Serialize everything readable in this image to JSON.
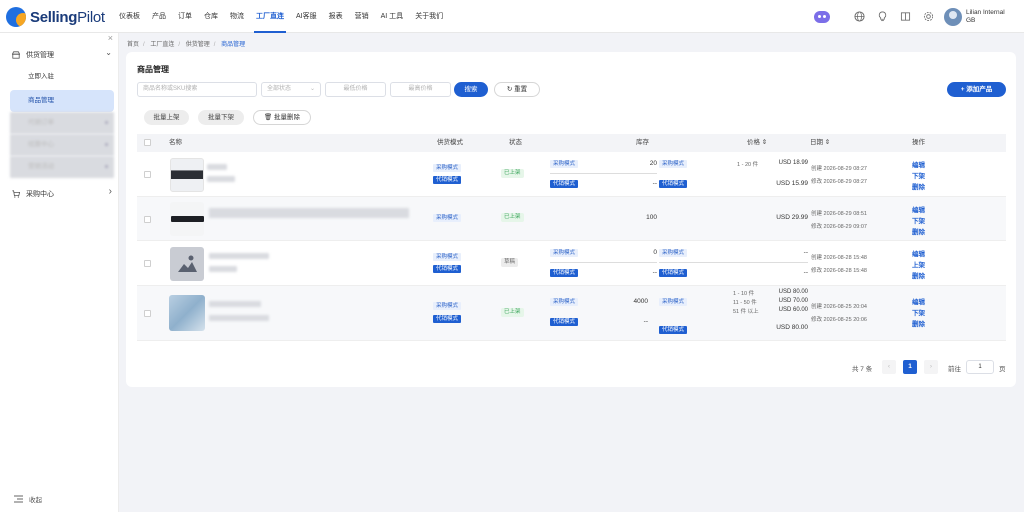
{
  "app": {
    "name_bold": "Selling",
    "name_light": "Pilot"
  },
  "nav": [
    "仪表板",
    "产品",
    "订单",
    "仓库",
    "物流",
    "工厂直连",
    "AI客服",
    "报表",
    "营销",
    "AI 工具",
    "关于我们"
  ],
  "user": {
    "name": "Lilian Internal",
    "sub": "GB"
  },
  "sidebar": {
    "close": "×",
    "groups": [
      {
        "label": "供货管理",
        "chev": "⌄"
      },
      {
        "label": "采购中心",
        "chev": "›"
      }
    ],
    "items": [
      "立即入驻",
      "商品管理",
      "代销订单",
      "结算中心",
      "营销活动"
    ],
    "footer": "收起"
  },
  "breadcrumb": [
    "首页",
    "工厂直连",
    "供货管理",
    "商品管理"
  ],
  "page_title": "商品管理",
  "filters": {
    "search_placeholder": "商品名称或SKU搜索",
    "status_placeholder": "全部状态",
    "min_price_placeholder": "最低价格",
    "max_price_placeholder": "最高价格",
    "search_btn": "搜索",
    "reset_btn": "重置",
    "add_btn": "+ 添加产品"
  },
  "batch": {
    "up": "批量上架",
    "down": "批量下架",
    "delete": "批量删除"
  },
  "table": {
    "headers": {
      "name": "名称",
      "mode": "供货模式",
      "status": "状态",
      "stock": "库存",
      "price": "价格 ⇕",
      "date": "日期 ⇕",
      "ops": "操作"
    },
    "rows": [
      {
        "modes": [
          "采购模式",
          "代销模式"
        ],
        "status": "已上架",
        "stock": [
          {
            "tag": "采购模式",
            "val": "20"
          },
          {
            "tag": "代销模式",
            "val": "--"
          }
        ],
        "price": [
          {
            "tag": "采购模式",
            "tier": "1 - 20 件",
            "val": "USD 18.99"
          },
          {
            "tag": "代销模式",
            "val": "USD 15.99"
          }
        ],
        "date": [
          "创建 2026-08-29 08:27",
          "修改 2026-08-29 08:27"
        ],
        "ops": [
          "编辑",
          "下架",
          "删除"
        ]
      },
      {
        "modes": [
          "采购模式"
        ],
        "status": "已上架",
        "stock_single": "100",
        "price_single": "USD 29.99",
        "date": [
          "创建 2026-08-29 08:51",
          "修改 2026-08-29 09:07"
        ],
        "ops": [
          "编辑",
          "下架",
          "删除"
        ]
      },
      {
        "modes": [
          "采购模式",
          "代销模式"
        ],
        "status": "草稿",
        "stock": [
          {
            "tag": "采购模式",
            "val": "0"
          },
          {
            "tag": "代销模式",
            "val": "--"
          }
        ],
        "price": [
          {
            "tag": "采购模式",
            "val": "--"
          },
          {
            "tag": "代销模式",
            "val": "--"
          }
        ],
        "date": [
          "创建 2026-08-28 15:48",
          "修改 2026-08-28 15:48"
        ],
        "ops": [
          "编辑",
          "上架",
          "删除"
        ]
      },
      {
        "modes": [
          "采购模式",
          "代销模式"
        ],
        "status": "已上架",
        "stock": [
          {
            "tag": "采购模式",
            "val": "4000"
          },
          {
            "tag": "代销模式",
            "val": "--"
          }
        ],
        "price_tiers": [
          {
            "tier": "1 - 10 件",
            "val": "USD 80.00"
          },
          {
            "tier": "11 - 50 件",
            "val": "USD 70.00"
          },
          {
            "tier": "51 件 以上",
            "val": "USD 60.00"
          }
        ],
        "price_consign": "USD 80.00",
        "price_tags": [
          "采购模式",
          "代销模式"
        ],
        "date": [
          "创建 2026-08-25 20:04",
          "修改 2026-08-25 20:06"
        ],
        "ops": [
          "编辑",
          "下架",
          "删除"
        ]
      }
    ]
  },
  "pagination": {
    "total": "共 7 条",
    "prev": "‹",
    "current": "1",
    "next": "›",
    "goto": "前往",
    "page_input": "1",
    "page_unit": "页"
  }
}
